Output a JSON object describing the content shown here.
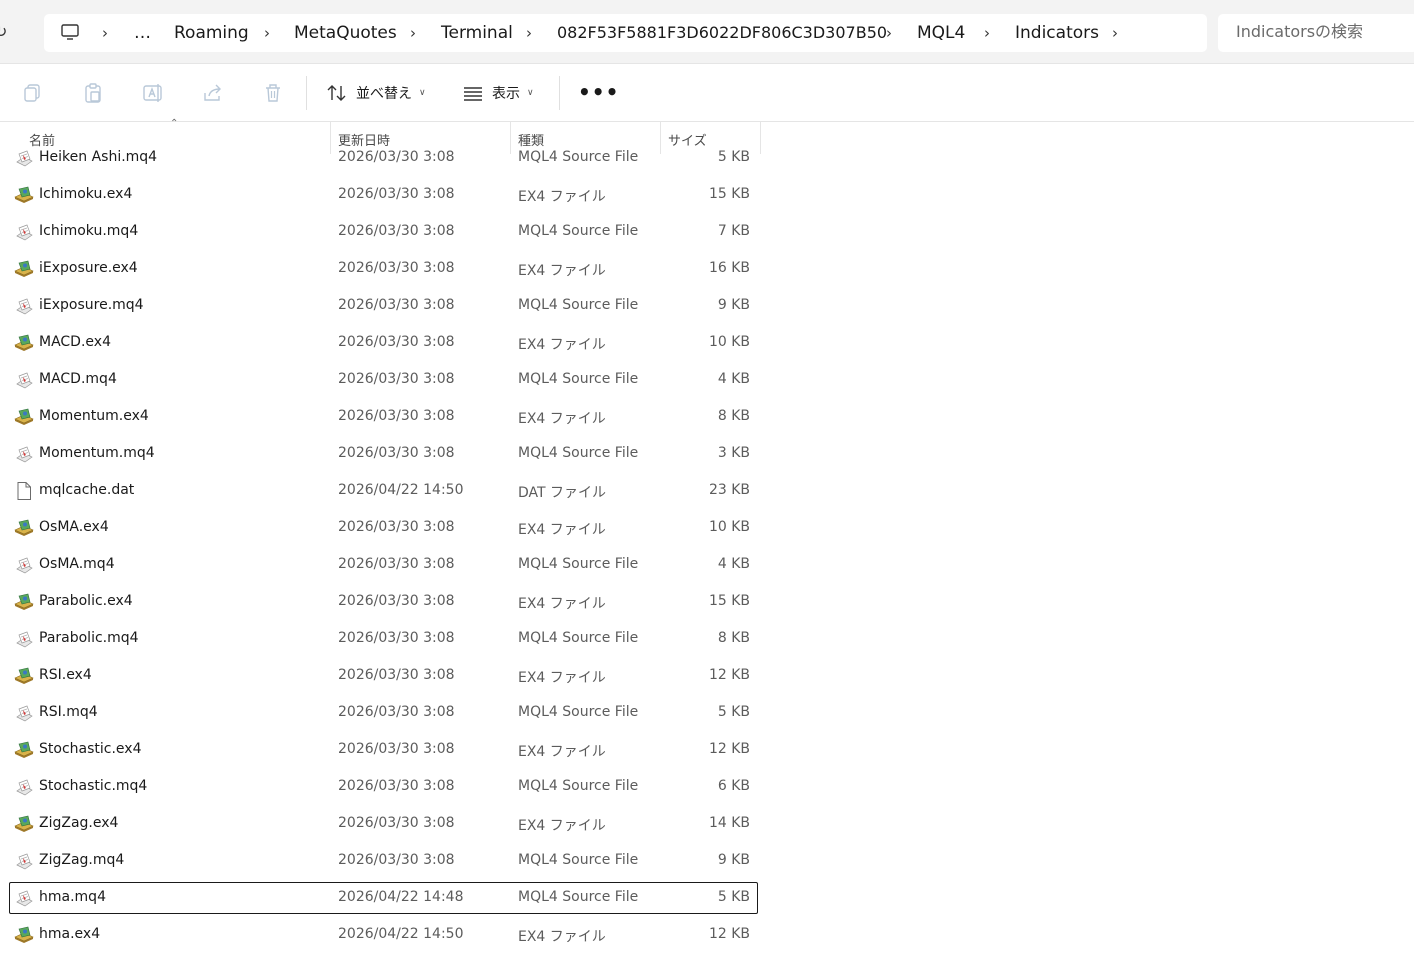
{
  "address": {
    "overflow": "…",
    "crumbs": [
      "Roaming",
      "MetaQuotes",
      "Terminal",
      "082F53F5881F3D6022DF806C3D307B50",
      "MQL4",
      "Indicators"
    ]
  },
  "search": {
    "placeholder": "Indicatorsの検索"
  },
  "toolbar": {
    "sort_label": "並べ替え",
    "view_label": "表示",
    "more_label": "•••"
  },
  "columns": {
    "name": "名前",
    "date": "更新日時",
    "type": "種類",
    "size": "サイズ"
  },
  "files": [
    {
      "name": "Heiken Ashi.mq4",
      "date": "2026/03/30 3:08",
      "type": "MQL4 Source File",
      "size": "5 KB",
      "icon": "mq4-source-icon"
    },
    {
      "name": "Ichimoku.ex4",
      "date": "2026/03/30 3:08",
      "type": "EX4 ファイル",
      "size": "15 KB",
      "icon": "ex4-file-icon"
    },
    {
      "name": "Ichimoku.mq4",
      "date": "2026/03/30 3:08",
      "type": "MQL4 Source File",
      "size": "7 KB",
      "icon": "mq4-source-icon"
    },
    {
      "name": "iExposure.ex4",
      "date": "2026/03/30 3:08",
      "type": "EX4 ファイル",
      "size": "16 KB",
      "icon": "ex4-file-icon"
    },
    {
      "name": "iExposure.mq4",
      "date": "2026/03/30 3:08",
      "type": "MQL4 Source File",
      "size": "9 KB",
      "icon": "mq4-source-icon"
    },
    {
      "name": "MACD.ex4",
      "date": "2026/03/30 3:08",
      "type": "EX4 ファイル",
      "size": "10 KB",
      "icon": "ex4-file-icon"
    },
    {
      "name": "MACD.mq4",
      "date": "2026/03/30 3:08",
      "type": "MQL4 Source File",
      "size": "4 KB",
      "icon": "mq4-source-icon"
    },
    {
      "name": "Momentum.ex4",
      "date": "2026/03/30 3:08",
      "type": "EX4 ファイル",
      "size": "8 KB",
      "icon": "ex4-file-icon"
    },
    {
      "name": "Momentum.mq4",
      "date": "2026/03/30 3:08",
      "type": "MQL4 Source File",
      "size": "3 KB",
      "icon": "mq4-source-icon"
    },
    {
      "name": "mqlcache.dat",
      "date": "2026/04/22 14:50",
      "type": "DAT ファイル",
      "size": "23 KB",
      "icon": "blank-file-icon"
    },
    {
      "name": "OsMA.ex4",
      "date": "2026/03/30 3:08",
      "type": "EX4 ファイル",
      "size": "10 KB",
      "icon": "ex4-file-icon"
    },
    {
      "name": "OsMA.mq4",
      "date": "2026/03/30 3:08",
      "type": "MQL4 Source File",
      "size": "4 KB",
      "icon": "mq4-source-icon"
    },
    {
      "name": "Parabolic.ex4",
      "date": "2026/03/30 3:08",
      "type": "EX4 ファイル",
      "size": "15 KB",
      "icon": "ex4-file-icon"
    },
    {
      "name": "Parabolic.mq4",
      "date": "2026/03/30 3:08",
      "type": "MQL4 Source File",
      "size": "8 KB",
      "icon": "mq4-source-icon"
    },
    {
      "name": "RSI.ex4",
      "date": "2026/03/30 3:08",
      "type": "EX4 ファイル",
      "size": "12 KB",
      "icon": "ex4-file-icon"
    },
    {
      "name": "RSI.mq4",
      "date": "2026/03/30 3:08",
      "type": "MQL4 Source File",
      "size": "5 KB",
      "icon": "mq4-source-icon"
    },
    {
      "name": "Stochastic.ex4",
      "date": "2026/03/30 3:08",
      "type": "EX4 ファイル",
      "size": "12 KB",
      "icon": "ex4-file-icon"
    },
    {
      "name": "Stochastic.mq4",
      "date": "2026/03/30 3:08",
      "type": "MQL4 Source File",
      "size": "6 KB",
      "icon": "mq4-source-icon"
    },
    {
      "name": "ZigZag.ex4",
      "date": "2026/03/30 3:08",
      "type": "EX4 ファイル",
      "size": "14 KB",
      "icon": "ex4-file-icon"
    },
    {
      "name": "ZigZag.mq4",
      "date": "2026/03/30 3:08",
      "type": "MQL4 Source File",
      "size": "9 KB",
      "icon": "mq4-source-icon"
    },
    {
      "name": "hma.mq4",
      "date": "2026/04/22 14:48",
      "type": "MQL4 Source File",
      "size": "5 KB",
      "icon": "mq4-source-icon",
      "focused": true
    },
    {
      "name": "hma.ex4",
      "date": "2026/04/22 14:50",
      "type": "EX4 ファイル",
      "size": "12 KB",
      "icon": "ex4-file-icon"
    }
  ]
}
